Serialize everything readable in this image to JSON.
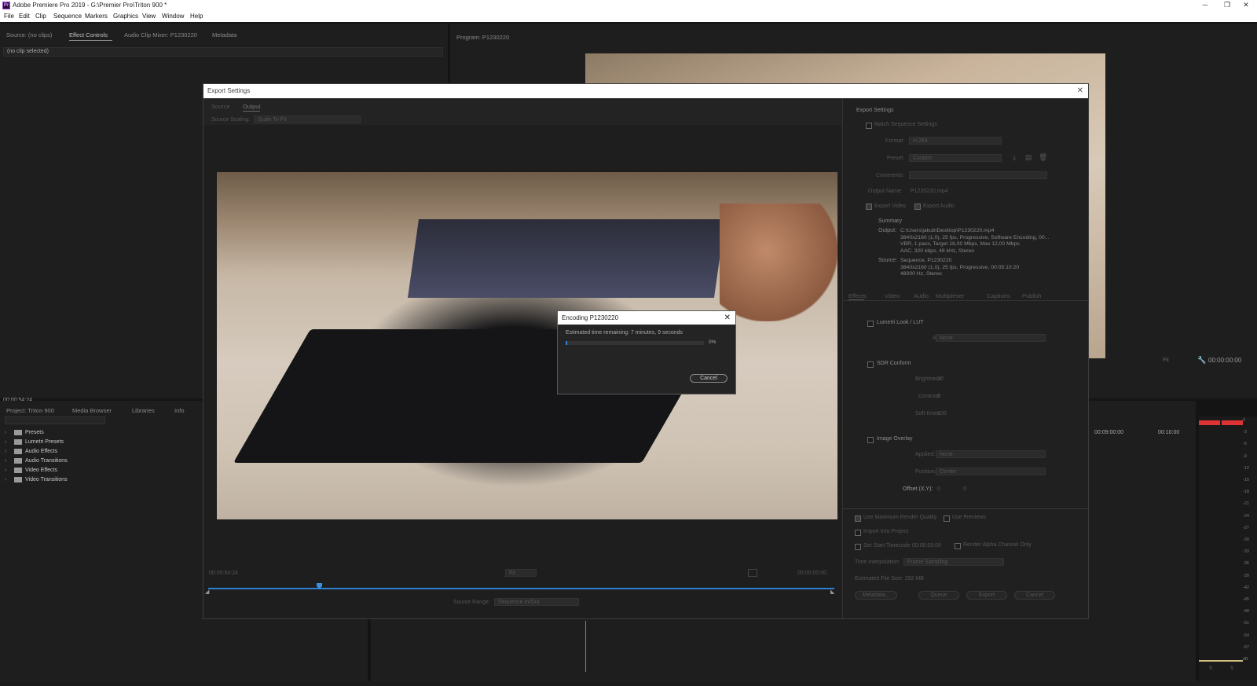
{
  "window": {
    "title": "Adobe Premiere Pro 2019 - G:\\Premier Pro\\Triton 900 *",
    "app_icon": "Pr",
    "controls": {
      "minimize": "─",
      "restore": "❐",
      "close": "✕"
    }
  },
  "menu": [
    "File",
    "Edit",
    "Clip",
    "Sequence",
    "Markers",
    "Graphics",
    "View",
    "Window",
    "Help"
  ],
  "source_panel": {
    "tabs": [
      "Source: (no clips)",
      "Effect Controls",
      "Audio Clip Mixer: P1230220",
      "Metadata"
    ],
    "no_clip": "(no clip selected)",
    "timecode": "00:00:54:24"
  },
  "program_panel": {
    "title": "Program: P1230220",
    "fit": "Fit",
    "timecode": "00:00:00:00"
  },
  "project_panel": {
    "tabs": [
      "Project: Triton 900",
      "Media Browser",
      "Libraries",
      "Info"
    ],
    "items": [
      "Presets",
      "Lumetri Presets",
      "Audio Effects",
      "Audio Transitions",
      "Video Effects",
      "Video Transitions"
    ]
  },
  "timeline": {
    "ruler": [
      "00:09:00:00",
      "00:10:00"
    ]
  },
  "audio_meter": {
    "ticks": [
      "0",
      "-3",
      "-6",
      "-9",
      "-12",
      "-15",
      "-18",
      "-21",
      "-24",
      "-27",
      "-30",
      "-33",
      "-36",
      "-39",
      "-42",
      "-45",
      "-48",
      "-51",
      "-54",
      "-57",
      "dB"
    ],
    "footer": [
      "S",
      "S"
    ]
  },
  "export_dialog": {
    "title": "Export Settings",
    "close": "✕",
    "tabs": [
      "Source",
      "Output"
    ],
    "source_scaling_label": "Source Scaling:",
    "source_scaling_value": "Scale To Fit",
    "current_time": "00:00:54:24",
    "end_time": "00:00:00:00",
    "fit_value": "Fit",
    "source_range_label": "Source Range:",
    "source_range_value": "Sequence In/Out",
    "settings": {
      "section": "Export Settings",
      "match_sequence": "Match Sequence Settings",
      "format_label": "Format:",
      "format_value": "H.264",
      "preset_label": "Preset:",
      "preset_value": "Custom",
      "comments_label": "Comments:",
      "output_name_label": "Output Name:",
      "output_name_value": "P1230220.mp4",
      "export_video": "Export Video",
      "export_audio": "Export Audio",
      "summary_title": "Summary",
      "output_label": "Output:",
      "output_lines": [
        "C:\\Users\\jakub\\Desktop\\P1230220.mp4",
        "3840x2160 (1,0), 25 fps, Progressive, Software Encoding, 00:..",
        "VBR, 1 pass, Target 18,00 Mbps, Max 12,00 Mbps",
        "AAC, 320 kbps, 48 kHz, Stereo"
      ],
      "source_label": "Source:",
      "source_lines": [
        "Sequence, P1230220",
        "3840x2160 (1,0), 25 fps, Progressive, 00:05:10:20",
        "48000 Hz, Stereo"
      ]
    },
    "effect_tabs": [
      "Effects",
      "Video",
      "Audio",
      "Multiplexer",
      "Captions",
      "Publish"
    ],
    "effects": {
      "lumetri": "Lumetri Look / LUT",
      "applied_label": "Applied:",
      "lumetri_applied": "None",
      "sdr": "SDR Conform",
      "brightness_label": "Brightness:",
      "brightness": "10",
      "contrast_label": "Contrast:",
      "contrast": "0",
      "soft_knee_label": "Soft Knee:",
      "soft_knee": "100",
      "overlay": "Image Overlay",
      "overlay_applied": "None",
      "position_label": "Position:",
      "position": "Center",
      "offset_label": "Offset (X,Y):",
      "offset_x": "0",
      "offset_y": "0"
    },
    "bottom": {
      "max_render": "Use Maximum Render Quality",
      "use_previews": "Use Previews",
      "import_project": "Import Into Project",
      "set_start": "Set Start Timecode",
      "start_tc": "00:00:00:00",
      "render_alpha": "Render Alpha Channel Only",
      "time_interp_label": "Time Interpolation:",
      "time_interp_value": "Frame Sampling",
      "file_size": "Estimated File Size:  282 MB",
      "buttons": [
        "Metadata...",
        "Queue",
        "Export",
        "Cancel"
      ]
    }
  },
  "encoding_dialog": {
    "title": "Encoding P1230220",
    "close": "✕",
    "status": "Estimated time remaining: 7 minutes, 9 seconds",
    "progress": 0.01,
    "percent": "0%",
    "cancel": "Cancel"
  }
}
